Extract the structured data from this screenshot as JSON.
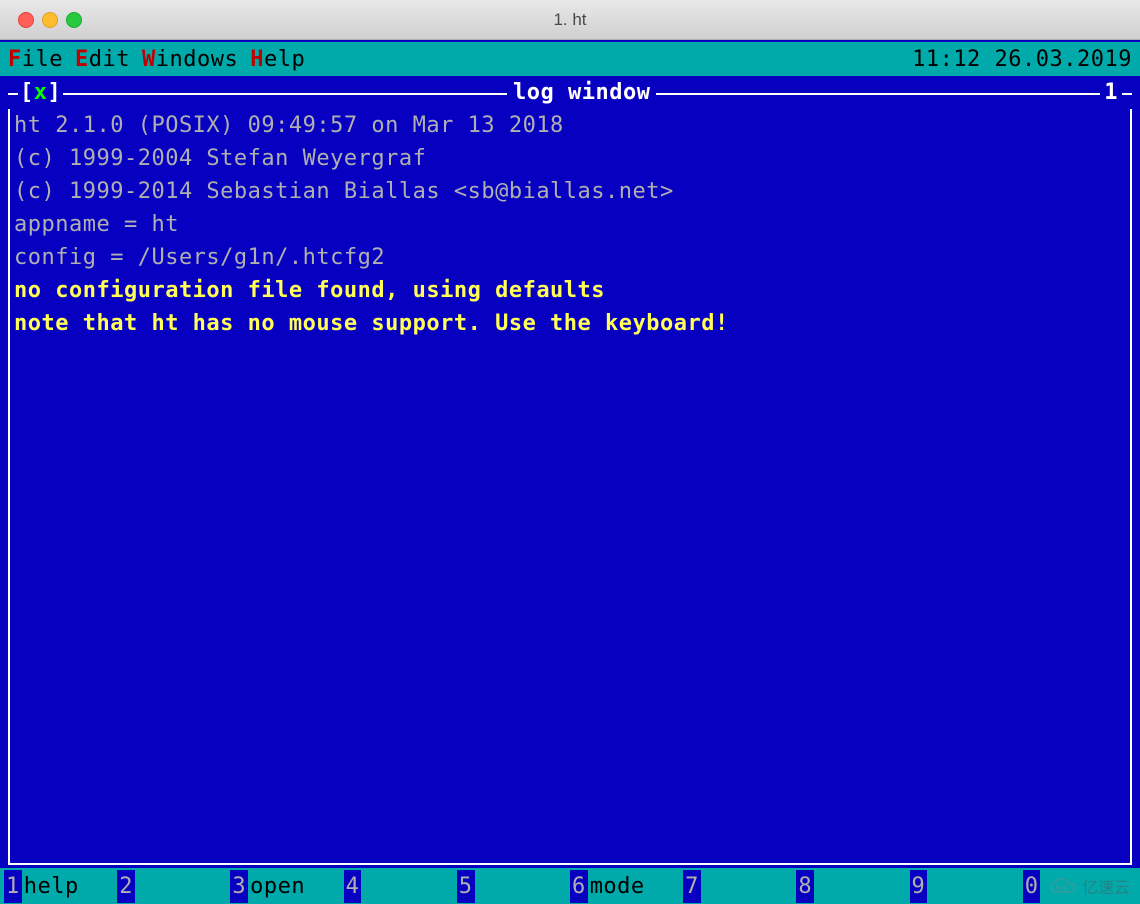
{
  "window": {
    "title": "1. ht"
  },
  "menubar": {
    "items": [
      {
        "hotkey": "F",
        "rest": "ile"
      },
      {
        "hotkey": "E",
        "rest": "dit"
      },
      {
        "hotkey": "W",
        "rest": "indows"
      },
      {
        "hotkey": "H",
        "rest": "elp"
      }
    ],
    "clock": "11:12 26.03.2019"
  },
  "frame": {
    "close_left": "[",
    "close_x": "x",
    "close_right": "]",
    "title": "log window",
    "number": "1"
  },
  "log": {
    "lines": [
      {
        "text": "ht 2.1.0 (POSIX) 09:49:57 on Mar 13 2018",
        "highlight": false
      },
      {
        "text": "(c) 1999-2004 Stefan Weyergraf",
        "highlight": false
      },
      {
        "text": "(c) 1999-2014 Sebastian Biallas <sb@biallas.net>",
        "highlight": false
      },
      {
        "text": "appname = ht",
        "highlight": false
      },
      {
        "text": "config = /Users/g1n/.htcfg2",
        "highlight": false
      },
      {
        "text": "no configuration file found, using defaults",
        "highlight": true
      },
      {
        "text": "note that ht has no mouse support. Use the keyboard!",
        "highlight": true
      }
    ]
  },
  "fkeys": [
    {
      "num": "1",
      "label": "help"
    },
    {
      "num": "2",
      "label": ""
    },
    {
      "num": "3",
      "label": "open"
    },
    {
      "num": "4",
      "label": ""
    },
    {
      "num": "5",
      "label": ""
    },
    {
      "num": "6",
      "label": "mode"
    },
    {
      "num": "7",
      "label": ""
    },
    {
      "num": "8",
      "label": ""
    },
    {
      "num": "9",
      "label": ""
    },
    {
      "num": "0",
      "label": ""
    }
  ],
  "watermark": {
    "text": "亿速云"
  }
}
